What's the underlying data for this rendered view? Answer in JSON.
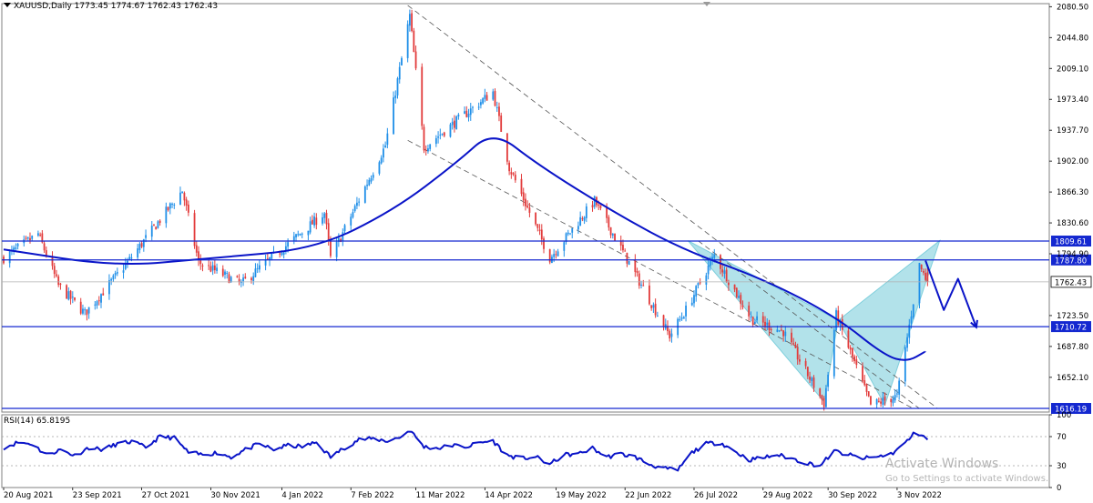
{
  "window": {
    "symbol_header": "XAUUSD,Daily  1773.45 1774.67 1762.43 1762.43",
    "rsi_header": "RSI(14) 65.8195"
  },
  "watermark": {
    "line1": "Activate Windows",
    "line2": "Go to Settings to activate Windows."
  },
  "colors": {
    "bull": "#1f8fe8",
    "bear": "#e23b3b",
    "ma": "#0a14c8",
    "level_line": "#1428d0",
    "pattern_fill": "#7fcfdc",
    "projection": "#0a14c8",
    "channel": "#555555"
  },
  "chart_data": [
    {
      "type": "candlestick",
      "symbol": "XAUUSD",
      "timeframe": "Daily",
      "last_bar": {
        "open": 1773.45,
        "high": 1774.67,
        "low": 1762.43,
        "close": 1762.43
      },
      "current_price_label": "1762.43",
      "y_axis_ticks": [
        "2080.50",
        "2044.80",
        "2009.10",
        "1973.40",
        "1937.70",
        "1902.00",
        "1866.30",
        "1830.60",
        "1794.90",
        "1723.50",
        "1687.80",
        "1652.10"
      ],
      "ylim": [
        1612,
        2084
      ],
      "x_axis_dates": [
        "20 Aug 2021",
        "23 Sep 2021",
        "27 Oct 2021",
        "30 Nov 2021",
        "4 Jan 2022",
        "7 Feb 2022",
        "11 Mar 2022",
        "14 Apr 2022",
        "19 May 2022",
        "22 Jun 2022",
        "26 Jul 2022",
        "29 Aug 2022",
        "30 Sep 2022",
        "3 Nov 2022"
      ],
      "price_path_anchors": [
        [
          "20 Aug 2021",
          1790
        ],
        [
          "6 Sep 2021",
          1818
        ],
        [
          "16 Sep 2021",
          1758
        ],
        [
          "29 Sep 2021",
          1726
        ],
        [
          "20 Oct 2021",
          1785
        ],
        [
          "16 Nov 2021",
          1868
        ],
        [
          "24 Nov 2021",
          1785
        ],
        [
          "15 Dec 2021",
          1760
        ],
        [
          "25 Jan 2022",
          1842
        ],
        [
          "28 Jan 2022",
          1790
        ],
        [
          "24 Feb 2022",
          1920
        ],
        [
          "8 Mar 2022",
          2070
        ],
        [
          "15 Mar 2022",
          1918
        ],
        [
          "18 Apr 2022",
          1982
        ],
        [
          "26 Apr 2022",
          1895
        ],
        [
          "16 May 2022",
          1790
        ],
        [
          "7 Jun 2022",
          1856
        ],
        [
          "14 Jul 2022",
          1700
        ],
        [
          "22 Jul 2022",
          1730
        ],
        [
          "5 Aug 2022",
          1793
        ],
        [
          "23 Aug 2022",
          1720
        ],
        [
          "8 Sep 2022",
          1705
        ],
        [
          "28 Sep 2022",
          1622
        ],
        [
          "4 Oct 2022",
          1724
        ],
        [
          "21 Oct 2022",
          1620
        ],
        [
          "3 Nov 2022",
          1630
        ],
        [
          "9 Nov 2022",
          1712
        ],
        [
          "14 Nov 2022",
          1782
        ],
        [
          "18 Nov 2022",
          1762
        ]
      ],
      "moving_average_anchors": [
        [
          "20 Aug 2021",
          1800
        ],
        [
          "15 Oct 2021",
          1780
        ],
        [
          "30 Nov 2021",
          1790
        ],
        [
          "20 Jan 2022",
          1800
        ],
        [
          "28 Feb 2022",
          1845
        ],
        [
          "31 Mar 2022",
          1900
        ],
        [
          "18 Apr 2022",
          1938
        ],
        [
          "10 May 2022",
          1898
        ],
        [
          "15 Jun 2022",
          1845
        ],
        [
          "20 Jul 2022",
          1800
        ],
        [
          "30 Aug 2022",
          1765
        ],
        [
          "4 Oct 2022",
          1722
        ],
        [
          "28 Oct 2022",
          1677
        ],
        [
          "8 Nov 2022",
          1670
        ],
        [
          "17 Nov 2022",
          1682
        ]
      ],
      "horizontal_levels": [
        {
          "value": 1809.61,
          "label": "1809.61"
        },
        {
          "value": 1787.8,
          "label": "1787.80"
        },
        {
          "value": 1710.72,
          "label": "1710.72"
        },
        {
          "value": 1616.19,
          "label": "1616.19"
        }
      ],
      "channel_lines": [
        [
          [
            "7 Mar 2022",
            2082
          ],
          [
            "23 Nov 2022",
            1616
          ]
        ],
        [
          [
            "7 Mar 2022",
            1926
          ],
          [
            "11 Nov 2022",
            1616
          ]
        ],
        [
          [
            "28 Jul 2022",
            1810
          ],
          [
            "14 Nov 2022",
            1616
          ]
        ]
      ],
      "harmonic_pattern": [
        [
          [
            "23 Jul 2022",
            1810
          ],
          [
            "28 Sep 2022",
            1624
          ],
          [
            "5 Oct 2022",
            1718
          ]
        ],
        [
          [
            "5 Oct 2022",
            1718
          ],
          [
            "28 Oct 2022",
            1620
          ],
          [
            "24 Nov 2022",
            1810
          ]
        ]
      ],
      "projection_path": [
        [
          "17 Nov 2022",
          1787
        ],
        [
          "26 Nov 2022",
          1730
        ],
        [
          "3 Dec 2022",
          1766
        ],
        [
          "12 Dec 2022",
          1710
        ]
      ]
    },
    {
      "type": "line",
      "name": "RSI(14)",
      "value": 65.8195,
      "y_axis_ticks": [
        "100",
        "70",
        "30",
        "0"
      ],
      "ylim": [
        0,
        100
      ],
      "levels": [
        70,
        30
      ],
      "rsi_anchors": [
        [
          "20 Aug 2021",
          55
        ],
        [
          "27 Aug 2021",
          62
        ],
        [
          "3 Sep 2021",
          60
        ],
        [
          "10 Sep 2021",
          45
        ],
        [
          "17 Sep 2021",
          52
        ],
        [
          "24 Sep 2021",
          44
        ],
        [
          "1 Oct 2021",
          55
        ],
        [
          "8 Oct 2021",
          52
        ],
        [
          "15 Oct 2021",
          60
        ],
        [
          "22 Oct 2021",
          63
        ],
        [
          "29 Oct 2021",
          55
        ],
        [
          "5 Nov 2021",
          70
        ],
        [
          "12 Nov 2021",
          68
        ],
        [
          "19 Nov 2021",
          48
        ],
        [
          "26 Nov 2021",
          45
        ],
        [
          "3 Dec 2021",
          48
        ],
        [
          "10 Dec 2021",
          42
        ],
        [
          "17 Dec 2021",
          52
        ],
        [
          "24 Dec 2021",
          60
        ],
        [
          "31 Dec 2021",
          52
        ],
        [
          "7 Jan 2022",
          58
        ],
        [
          "14 Jan 2022",
          56
        ],
        [
          "21 Jan 2022",
          62
        ],
        [
          "28 Jan 2022",
          42
        ],
        [
          "4 Feb 2022",
          55
        ],
        [
          "11 Feb 2022",
          66
        ],
        [
          "18 Feb 2022",
          67
        ],
        [
          "25 Feb 2022",
          64
        ],
        [
          "4 Mar 2022",
          70
        ],
        [
          "8 Mar 2022",
          79
        ],
        [
          "15 Mar 2022",
          56
        ],
        [
          "22 Mar 2022",
          54
        ],
        [
          "29 Mar 2022",
          58
        ],
        [
          "5 Apr 2022",
          56
        ],
        [
          "12 Apr 2022",
          62
        ],
        [
          "18 Apr 2022",
          64
        ],
        [
          "25 Apr 2022",
          44
        ],
        [
          "2 May 2022",
          40
        ],
        [
          "9 May 2022",
          42
        ],
        [
          "16 May 2022",
          32
        ],
        [
          "23 May 2022",
          45
        ],
        [
          "30 May 2022",
          46
        ],
        [
          "6 Jun 2022",
          54
        ],
        [
          "13 Jun 2022",
          42
        ],
        [
          "20 Jun 2022",
          46
        ],
        [
          "27 Jun 2022",
          42
        ],
        [
          "4 Jul 2022",
          32
        ],
        [
          "11 Jul 2022",
          26
        ],
        [
          "18 Jul 2022",
          24
        ],
        [
          "25 Jul 2022",
          48
        ],
        [
          "1 Aug 2022",
          60
        ],
        [
          "8 Aug 2022",
          62
        ],
        [
          "15 Aug 2022",
          50
        ],
        [
          "22 Aug 2022",
          38
        ],
        [
          "29 Aug 2022",
          41
        ],
        [
          "5 Sep 2022",
          45
        ],
        [
          "12 Sep 2022",
          40
        ],
        [
          "19 Sep 2022",
          34
        ],
        [
          "26 Sep 2022",
          30
        ],
        [
          "3 Oct 2022",
          50
        ],
        [
          "10 Oct 2022",
          45
        ],
        [
          "17 Oct 2022",
          40
        ],
        [
          "24 Oct 2022",
          42
        ],
        [
          "31 Oct 2022",
          46
        ],
        [
          "4 Nov 2022",
          54
        ],
        [
          "8 Nov 2022",
          64
        ],
        [
          "11 Nov 2022",
          73
        ],
        [
          "15 Nov 2022",
          74
        ],
        [
          "18 Nov 2022",
          65.8
        ]
      ]
    }
  ]
}
